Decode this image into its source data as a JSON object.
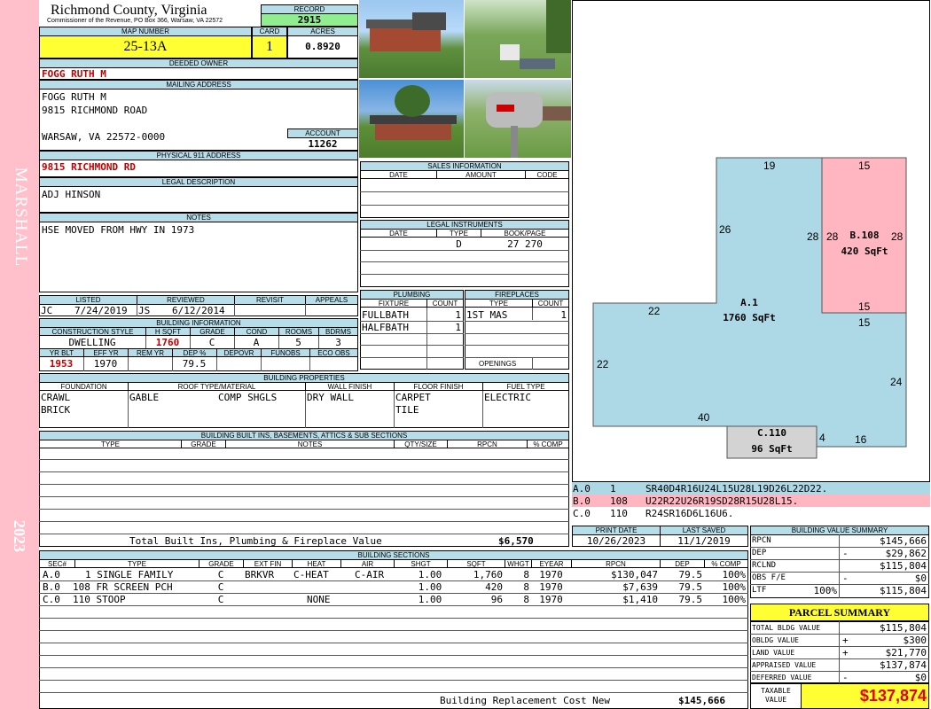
{
  "sidebar": {
    "district": "MARSHALL",
    "year": "2023"
  },
  "county": {
    "name": "Richmond County, Virginia",
    "address": "Commissioner of the Revenue, PO Box 366, Warsaw, VA 22572"
  },
  "record": {
    "label": "RECORD",
    "value": "2915"
  },
  "map": {
    "label": "MAP NUMBER",
    "value": "25-13A"
  },
  "card": {
    "label": "CARD",
    "value": "1"
  },
  "acres": {
    "label": "ACRES",
    "value": "0.8920"
  },
  "owner": {
    "label": "DEEDED OWNER",
    "value": "FOGG RUTH M"
  },
  "mailing": {
    "label": "MAILING ADDRESS",
    "line1": "FOGG RUTH M",
    "line2": "9815 RICHMOND ROAD",
    "line3": "WARSAW, VA 22572-0000"
  },
  "account": {
    "label": "ACCOUNT",
    "value": "11262"
  },
  "physical": {
    "label": "PHYSICAL 911 ADDRESS",
    "value": "9815 RICHMOND RD"
  },
  "legal": {
    "label": "LEGAL DESCRIPTION",
    "value": "ADJ HINSON"
  },
  "notes": {
    "label": "NOTES",
    "value": "HSE MOVED FROM HWY IN 1973"
  },
  "sales": {
    "label": "SALES INFORMATION",
    "cols": [
      "DATE",
      "AMOUNT",
      "CODE"
    ]
  },
  "instruments": {
    "label": "LEGAL INSTRUMENTS",
    "cols": [
      "DATE",
      "TYPE",
      "BOOK/PAGE"
    ],
    "row": {
      "date": "",
      "type": "D",
      "book": "27 270"
    }
  },
  "listed": {
    "listed_label": "LISTED",
    "listed_by": "JC",
    "listed_date": "7/24/2019",
    "reviewed_label": "REVIEWED",
    "reviewed_by": "JS",
    "reviewed_date": "6/12/2014",
    "revisit_label": "REVISIT",
    "appeals_label": "APPEALS"
  },
  "plumbing": {
    "label": "PLUMBING",
    "fixture_label": "FIXTURE",
    "count_label": "COUNT",
    "rows": [
      {
        "fixture": "FULLBATH",
        "count": "1"
      },
      {
        "fixture": "HALFBATH",
        "count": "1"
      }
    ]
  },
  "fireplaces": {
    "label": "FIREPLACES",
    "type_label": "TYPE",
    "count_label": "COUNT",
    "rows": [
      {
        "type": "1ST MAS",
        "count": "1"
      }
    ],
    "openings_label": "OPENINGS"
  },
  "building": {
    "label": "BUILDING INFORMATION",
    "h": [
      "CONSTRUCTION STYLE",
      "H SQFT",
      "GRADE",
      "COND",
      "ROOMS",
      "BDRMS"
    ],
    "v": {
      "style": "DWELLING",
      "sqft": "1760",
      "grade": "C",
      "cond": "A",
      "rooms": "5",
      "bdrms": "3"
    },
    "h2": [
      "YR BLT",
      "EFF YR",
      "REM YR",
      "DEP %",
      "DEPOVR",
      "FUNOBS",
      "ECO OBS"
    ],
    "v2": {
      "yrblt": "1953",
      "effyr": "1970",
      "remyr": "",
      "dep": "79.5"
    }
  },
  "props": {
    "label": "BUILDING PROPERTIES",
    "h": [
      "FOUNDATION",
      "ROOF TYPE/MATERIAL",
      "WALL FINISH",
      "FLOOR FINISH",
      "FUEL TYPE"
    ],
    "foundation1": "CRAWL",
    "foundation2": "BRICK",
    "roof_type": "GABLE",
    "roof_mat": "COMP SHGLS",
    "wall": "DRY WALL",
    "floor1": "CARPET",
    "floor2": "TILE",
    "fuel": "ELECTRIC"
  },
  "builtins": {
    "label": "BUILDING BUILT INS, BASEMENTS, ATTICS & SUB SECTIONS",
    "h": [
      "TYPE",
      "GRADE",
      "NOTES",
      "QTY/SIZE",
      "RPCN",
      "% COMP"
    ],
    "total_label": "Total Built Ins, Plumbing & Fireplace Value",
    "total": "$6,570"
  },
  "printinfo": {
    "print_label": "PRINT DATE",
    "print_date": "10/26/2023",
    "saved_label": "LAST SAVED",
    "saved_date": "11/1/2019"
  },
  "sections": {
    "label": "BUILDING SECTIONS",
    "h": [
      "SEC#",
      "TYPE",
      "GRADE",
      "EXT FIN",
      "HEAT",
      "AIR",
      "SHGT",
      "SQFT",
      "WHGT",
      "EYEAR",
      "RPCN",
      "DEP",
      "% COMP"
    ],
    "rows": [
      {
        "sec": "A.0",
        "type": "1 SINGLE FAMILY",
        "grade": "C",
        "ext": "BRKVR",
        "heat": "C-HEAT",
        "air": "C-AIR",
        "shgt": "1.00",
        "sqft": "1,760",
        "whgt": "8",
        "eyear": "1970",
        "rpcn": "$130,047",
        "dep": "79.5",
        "comp": "100%"
      },
      {
        "sec": "B.0",
        "type": "108 FR SCREEN PCH",
        "grade": "C",
        "ext": "",
        "heat": "",
        "air": "",
        "shgt": "1.00",
        "sqft": "420",
        "whgt": "8",
        "eyear": "1970",
        "rpcn": "$7,639",
        "dep": "79.5",
        "comp": "100%"
      },
      {
        "sec": "C.0",
        "type": "110 STOOP",
        "grade": "C",
        "ext": "",
        "heat": "NONE",
        "air": "",
        "shgt": "1.00",
        "sqft": "96",
        "whgt": "8",
        "eyear": "1970",
        "rpcn": "$1,410",
        "dep": "79.5",
        "comp": "100%"
      }
    ],
    "cost_label": "Building Replacement Cost New",
    "cost": "$145,666"
  },
  "sketch": {
    "a_label": "A.1",
    "a_area": "1760 SqFt",
    "b_label": "B.108",
    "b_area": "420 SqFt",
    "c_label": "C.110",
    "c_area": "96 SqFt",
    "dims": {
      "top": "19",
      "top_b": "15",
      "left_upper": "26",
      "b_left1": "28",
      "b_left2": "28",
      "b_right": "28",
      "a_ledge": "22",
      "a_left": "22",
      "b_bottom": "15",
      "a_right_top": "15",
      "a_right": "24",
      "a_bottom": "40",
      "c_right": "4",
      "bottom_right": "16"
    },
    "colors": {
      "a": "#add8e6",
      "b": "#ffb6c1",
      "c": "#d3d3d3"
    }
  },
  "traverse": [
    {
      "sec": "A.0",
      "code": "1",
      "path": "SR40D4R16U24L15U28L19D26L22D22."
    },
    {
      "sec": "B.0",
      "code": "108",
      "path": "U22R22U26R19SD28R15U28L15."
    },
    {
      "sec": "C.0",
      "code": "110",
      "path": "R24SR16D6L16U6."
    }
  ],
  "bvs": {
    "label": "BUILDING VALUE SUMMARY",
    "rows": [
      {
        "k": "RPCN",
        "pre": "",
        "v": "$145,666"
      },
      {
        "k": "DEP",
        "pre": "-",
        "v": "$29,862"
      },
      {
        "k": "RCLND",
        "pre": "",
        "v": "$115,804"
      },
      {
        "k": "OBS F/E",
        "pre": "-",
        "v": "$0"
      },
      {
        "k": "LTF",
        "pre": "100%",
        "v": "$115,804"
      }
    ]
  },
  "parcel": {
    "label": "PARCEL SUMMARY",
    "rows": [
      {
        "k": "TOTAL BLDG VALUE",
        "pre": "",
        "v": "$115,804"
      },
      {
        "k": "OBLDG VALUE",
        "pre": "+",
        "v": "$300"
      },
      {
        "k": "LAND VALUE",
        "pre": "+",
        "v": "$21,770"
      },
      {
        "k": "APPRAISED VALUE",
        "pre": "",
        "v": "$137,874"
      },
      {
        "k": "DEFERRED VALUE",
        "pre": "-",
        "v": "$0"
      }
    ],
    "taxable_label1": "TAXABLE",
    "taxable_label2": "VALUE",
    "taxable": "$137,874"
  }
}
